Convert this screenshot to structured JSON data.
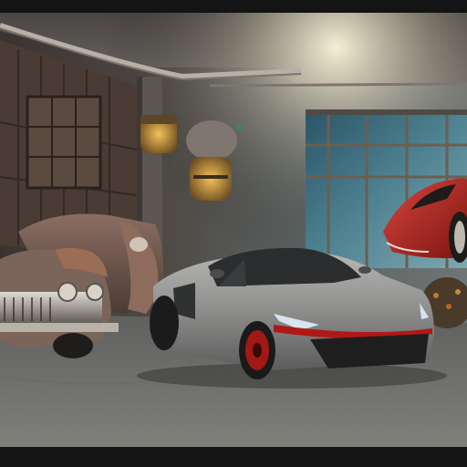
{
  "image": {
    "caption_strip_text": "",
    "scene_elements": [
      "vintage-car-left",
      "modern-gray-sports-car",
      "red-classic-car-right",
      "garage-lamp-left",
      "garage-lamp-center",
      "garage-window-right",
      "ceiling-pipes"
    ]
  },
  "colors": {
    "sports_car_body": "#8a8a8a",
    "sports_car_accent": "#b01818",
    "red_car_body": "#b3211f",
    "vintage_car_body": "#6a5248",
    "window_tint": "#3f6f82",
    "lamp_glow": "#e0a640"
  }
}
